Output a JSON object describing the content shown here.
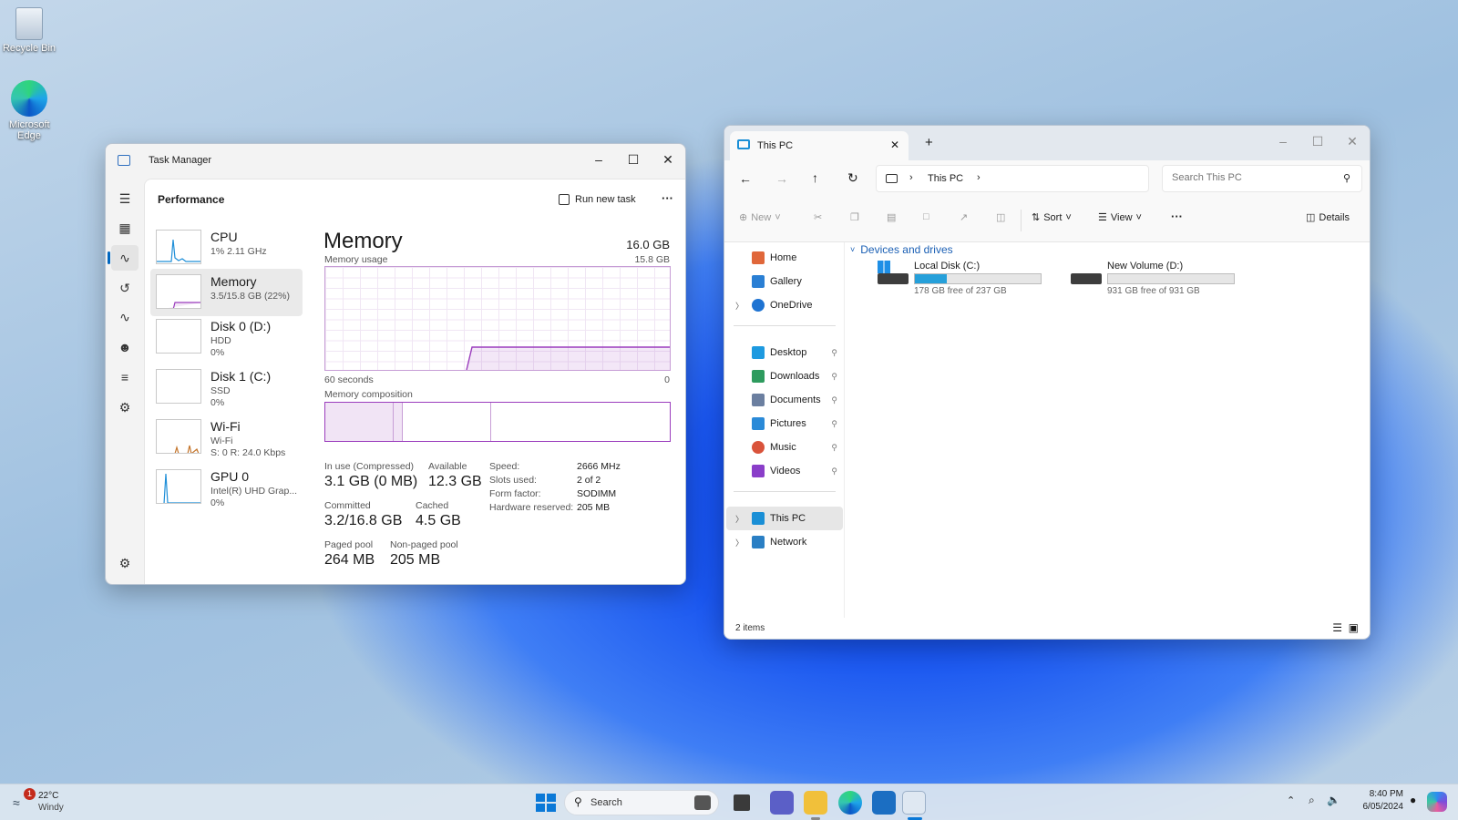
{
  "desktop": {
    "icons": [
      {
        "label": "Recycle Bin"
      },
      {
        "label": "Microsoft Edge"
      }
    ]
  },
  "task_manager": {
    "title": "Task Manager",
    "section": "Performance",
    "run_new_task": "Run new task",
    "more": "···",
    "items": [
      {
        "name": "CPU",
        "sub1": "1% 2.11 GHz",
        "sub2": ""
      },
      {
        "name": "Memory",
        "sub1": "3.5/15.8 GB (22%)",
        "sub2": ""
      },
      {
        "name": "Disk 0 (D:)",
        "sub1": "HDD",
        "sub2": "0%"
      },
      {
        "name": "Disk 1 (C:)",
        "sub1": "SSD",
        "sub2": "0%"
      },
      {
        "name": "Wi-Fi",
        "sub1": "Wi-Fi",
        "sub2": "S: 0 R: 24.0 Kbps"
      },
      {
        "name": "GPU 0",
        "sub1": "Intel(R) UHD Grap...",
        "sub2": "0%"
      }
    ],
    "memory": {
      "heading": "Memory",
      "total": "16.0 GB",
      "usage_label": "Memory usage",
      "usage_max": "15.8 GB",
      "time_left": "60 seconds",
      "time_right": "0",
      "composition_label": "Memory composition",
      "stats": {
        "in_use_label": "In use (Compressed)",
        "in_use": "3.1 GB (0 MB)",
        "available_label": "Available",
        "available": "12.3 GB",
        "committed_label": "Committed",
        "committed": "3.2/16.8 GB",
        "cached_label": "Cached",
        "cached": "4.5 GB",
        "paged_label": "Paged pool",
        "paged": "264 MB",
        "nonpaged_label": "Non-paged pool",
        "nonpaged": "205 MB"
      },
      "details": [
        {
          "k": "Speed:",
          "v": "2666 MHz"
        },
        {
          "k": "Slots used:",
          "v": "2 of 2"
        },
        {
          "k": "Form factor:",
          "v": "SODIMM"
        },
        {
          "k": "Hardware reserved:",
          "v": "205 MB"
        }
      ]
    }
  },
  "explorer": {
    "tab_title": "This PC",
    "new_tab": "+",
    "breadcrumb": "This PC",
    "search_placeholder": "Search This PC",
    "commands": {
      "new": "New",
      "sort": "Sort",
      "view": "View",
      "more": "···",
      "details": "Details"
    },
    "nav": [
      {
        "label": "Home"
      },
      {
        "label": "Gallery"
      },
      {
        "label": "OneDrive"
      },
      {
        "label": "Desktop"
      },
      {
        "label": "Downloads"
      },
      {
        "label": "Documents"
      },
      {
        "label": "Pictures"
      },
      {
        "label": "Music"
      },
      {
        "label": "Videos"
      },
      {
        "label": "This PC"
      },
      {
        "label": "Network"
      }
    ],
    "group": "Devices and drives",
    "drives": [
      {
        "name": "Local Disk (C:)",
        "free": "178 GB free of 237 GB",
        "used_fraction": 0.25
      },
      {
        "name": "New Volume (D:)",
        "free": "931 GB free of 931 GB",
        "used_fraction": 0.0
      }
    ],
    "status": "2 items"
  },
  "taskbar": {
    "weather_temp": "22°C",
    "weather_desc": "Windy",
    "weather_badge": "1",
    "search": "Search",
    "time": "8:40 PM",
    "date": "6/05/2024"
  }
}
